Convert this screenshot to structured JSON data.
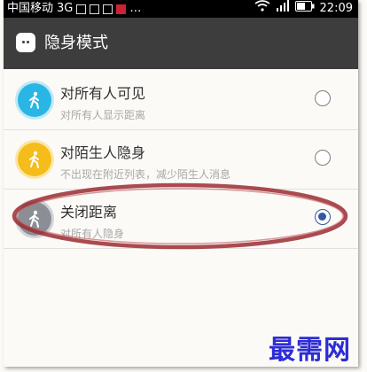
{
  "status_bar": {
    "carrier": "中国移动",
    "network": "3G",
    "battery_icon": "battery-icon",
    "time": "22:09"
  },
  "header": {
    "icon": "chat-bubble-icon",
    "title": "隐身模式"
  },
  "options": [
    {
      "label": "对所有人可见",
      "description": "对所有人显示距离",
      "icon": "walking-person-icon",
      "color": "#2ab6e4",
      "selected": false
    },
    {
      "label": "对陌生人隐身",
      "description": "不出现在附近列表，减少陌生人消息",
      "icon": "walking-person-icon",
      "color": "#f4bd1b",
      "selected": false
    },
    {
      "label": "关闭距离",
      "description": "对所有人隐身",
      "icon": "walking-person-icon",
      "color": "#8c8e95",
      "selected": true
    }
  ],
  "highlight_color": "#9b2b32",
  "watermark": "最需网"
}
